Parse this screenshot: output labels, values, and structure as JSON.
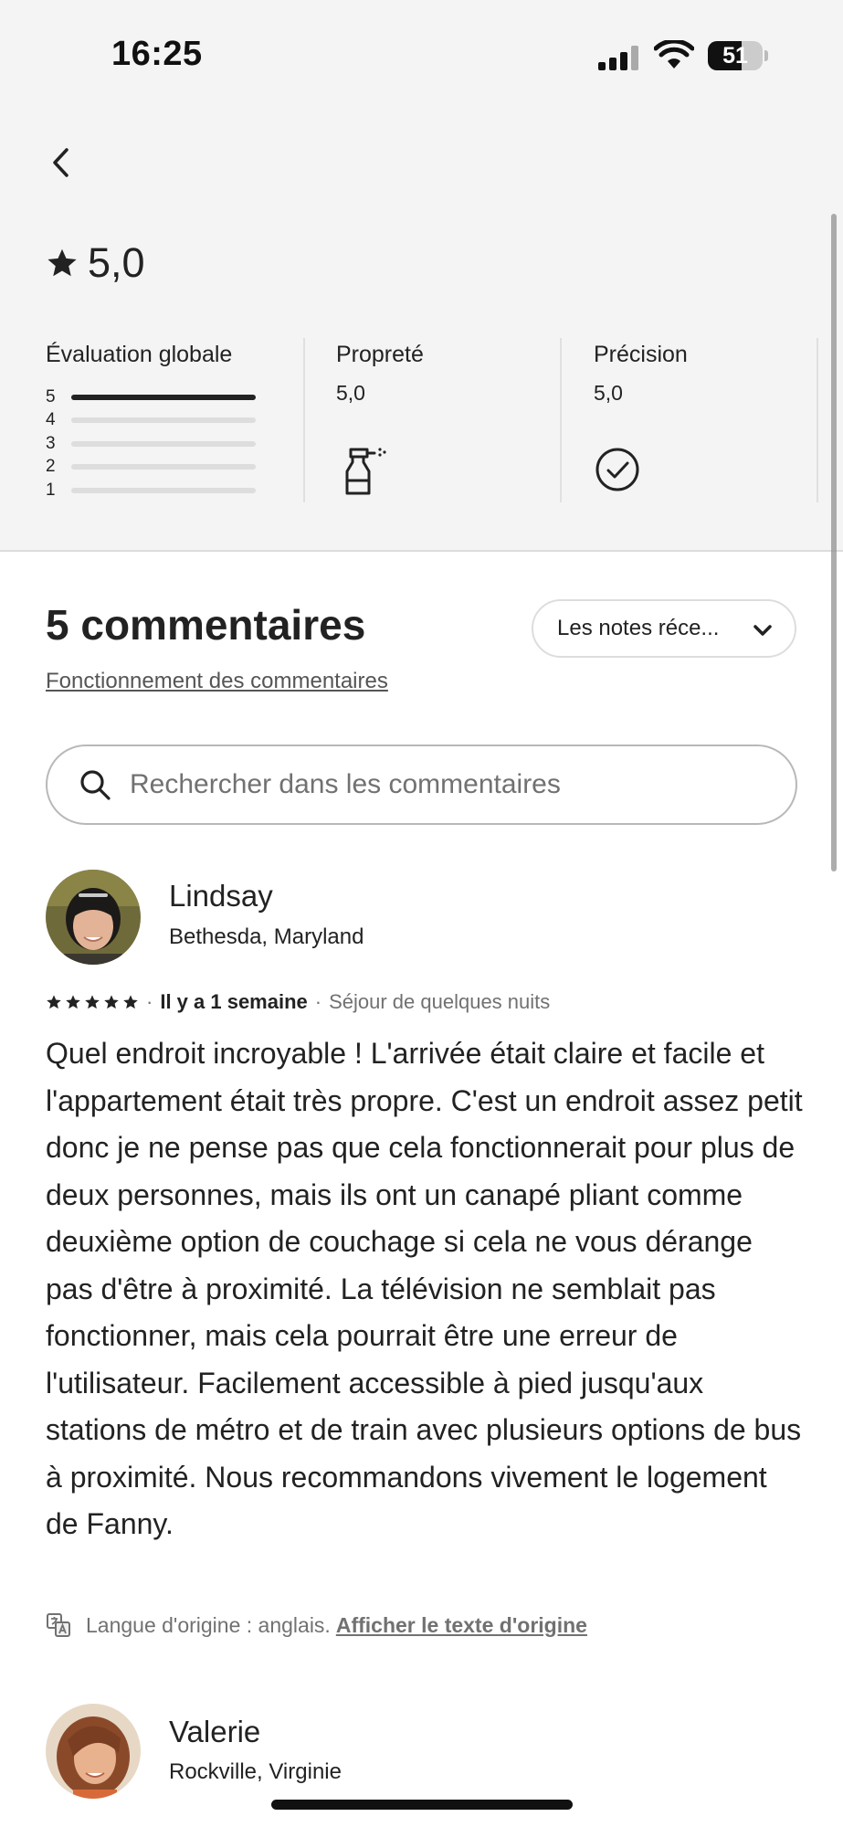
{
  "status_bar": {
    "time": "16:25",
    "battery": "51"
  },
  "summary": {
    "rating": "5,0"
  },
  "categories": [
    {
      "label": "Évaluation globale"
    },
    {
      "label": "Propreté",
      "value": "5,0",
      "icon": "spray-bottle-icon"
    },
    {
      "label": "Précision",
      "value": "5,0",
      "icon": "check-circle-icon"
    }
  ],
  "histogram": [
    {
      "stars": "5",
      "fraction": 1.0
    },
    {
      "stars": "4",
      "fraction": 0.0
    },
    {
      "stars": "3",
      "fraction": 0.0
    },
    {
      "stars": "2",
      "fraction": 0.0
    },
    {
      "stars": "1",
      "fraction": 0.0
    }
  ],
  "reviews_header": {
    "title": "5 commentaires",
    "how_link": "Fonctionnement des commentaires",
    "sort_label": "Les notes réce..."
  },
  "search": {
    "placeholder": "Rechercher dans les commentaires",
    "value": ""
  },
  "reviews": [
    {
      "name": "Lindsay",
      "location": "Bethesda, Maryland",
      "stars": 5,
      "when": "Il y a 1 semaine",
      "stay": "Séjour de quelques nuits",
      "text": "Quel endroit incroyable ! L'arrivée était claire et facile et l'appartement était très propre.  C'est un endroit assez petit donc je ne pense pas que cela fonctionnerait pour plus de deux personnes, mais ils ont un canapé pliant comme deuxième option de couchage si cela ne vous dérange pas d'être à proximité.  La télévision ne semblait pas fonctionner, mais cela pourrait être une erreur de l'utilisateur. Facilement accessible à pied jusqu'aux stations de métro et de train avec plusieurs options de bus à proximité. Nous recommandons vivement le logement de Fanny.",
      "original_language": "Langue d'origine : anglais.",
      "show_original": "Afficher le texte d'origine"
    },
    {
      "name": "Valerie",
      "location": "Rockville, Virginie"
    }
  ],
  "colors": {
    "text": "#222222",
    "muted": "#717171",
    "header_bg": "#f4f4f4",
    "track": "#dddddd"
  }
}
